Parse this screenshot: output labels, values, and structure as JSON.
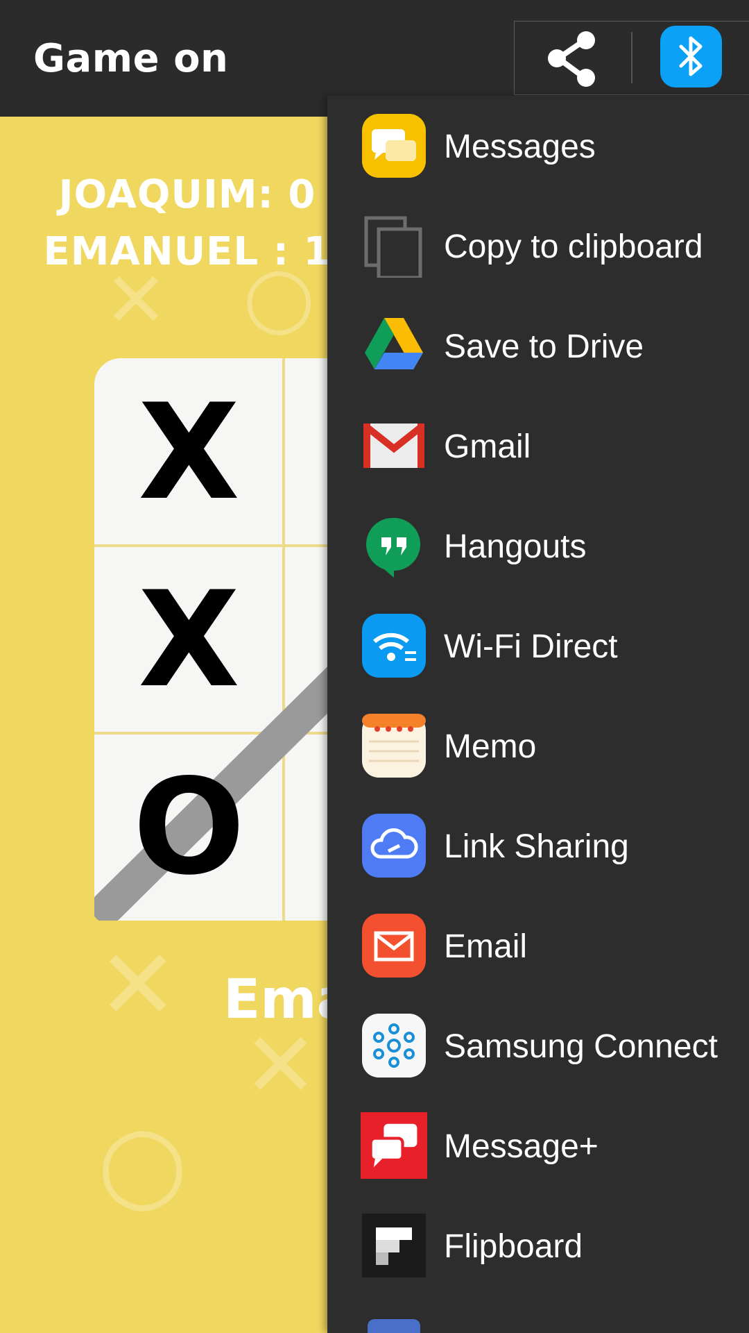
{
  "app_bar": {
    "title": "Game on",
    "share_icon": "share-icon",
    "bluetooth_icon": "bluetooth-icon"
  },
  "game": {
    "scores": [
      "JOAQUIM: 0",
      "EMANUEL : 1"
    ],
    "winner_text": "Eman",
    "board": [
      [
        "X",
        "",
        ""
      ],
      [
        "X",
        "",
        ""
      ],
      [
        "O",
        "",
        ""
      ]
    ],
    "background_color": "#f0d760"
  },
  "share_sheet": {
    "items": [
      {
        "label": "Messages",
        "icon": "messages-icon"
      },
      {
        "label": "Copy to clipboard",
        "icon": "copy-icon"
      },
      {
        "label": "Save to Drive",
        "icon": "drive-icon"
      },
      {
        "label": "Gmail",
        "icon": "gmail-icon"
      },
      {
        "label": "Hangouts",
        "icon": "hangouts-icon"
      },
      {
        "label": "Wi-Fi Direct",
        "icon": "wifi-direct-icon"
      },
      {
        "label": "Memo",
        "icon": "memo-icon"
      },
      {
        "label": "Link Sharing",
        "icon": "link-sharing-icon"
      },
      {
        "label": "Email",
        "icon": "email-icon"
      },
      {
        "label": "Samsung Connect",
        "icon": "samsung-connect-icon"
      },
      {
        "label": "Message+",
        "icon": "message-plus-icon"
      },
      {
        "label": "Flipboard",
        "icon": "flipboard-icon"
      }
    ]
  }
}
